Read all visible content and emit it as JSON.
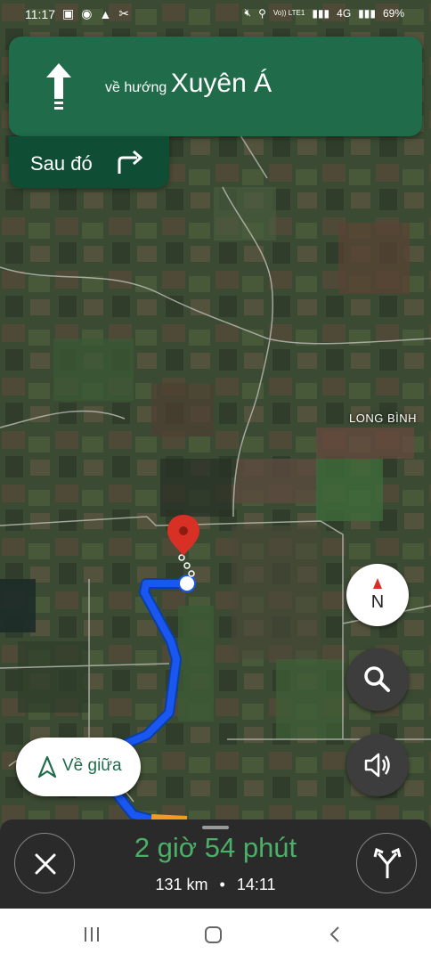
{
  "status_bar": {
    "time": "11:17",
    "left_icons": [
      "message-icon",
      "messenger-icon",
      "location-arrow-icon",
      "tools-icon"
    ],
    "right_icons": [
      "mute-icon",
      "location-pin-icon",
      "volte-icon",
      "signal-icon",
      "4g-icon",
      "signal-icon"
    ],
    "volte": "Vo)) LTE1",
    "network": "4G",
    "battery": "69%"
  },
  "navigation": {
    "maneuver_icon": "straight-arrow-icon",
    "toward_label": "về hướng",
    "destination": "Xuyên Á",
    "then_label": "Sau đó",
    "then_icon": "turn-right-icon"
  },
  "map": {
    "place_label": "LONG BÌNH",
    "compass_label": "N",
    "route_color": "#1a57f0",
    "destination_marker_color": "#d93025"
  },
  "recenter": {
    "label": "Về giữa"
  },
  "trip": {
    "duration": "2 giờ 54 phút",
    "distance": "131 km",
    "separator": "•",
    "arrival": "14:11",
    "eta_color": "#4caf67"
  },
  "system_nav": [
    "recent-apps-icon",
    "home-icon",
    "back-icon"
  ]
}
